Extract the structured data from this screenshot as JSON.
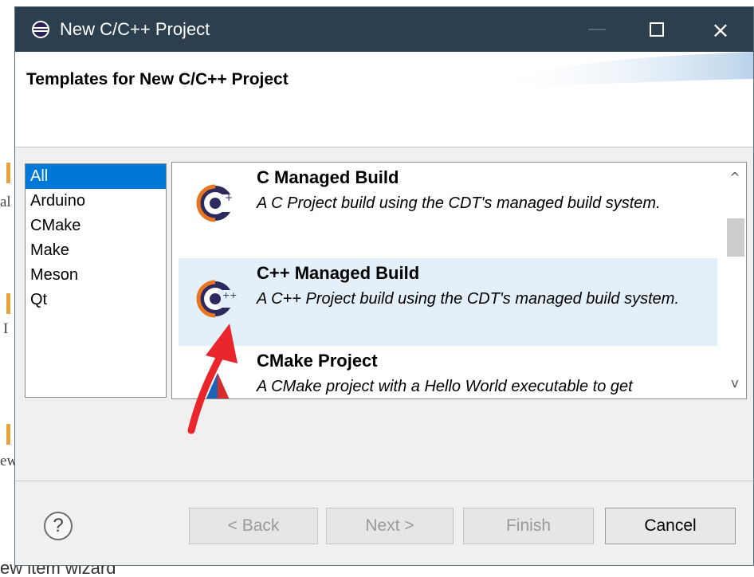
{
  "background": {
    "left_fragments": [
      "al",
      "I",
      "ew"
    ],
    "bottom_text": "ew item wizard"
  },
  "window": {
    "title": "New C/C++ Project",
    "app_icon": "eclipse-icon",
    "controls": {
      "minimize": "minimize-icon",
      "maximize": "maximize-icon",
      "close": "×"
    }
  },
  "header": {
    "title": "Templates for New C/C++ Project"
  },
  "categories": {
    "selected": "All",
    "items": [
      "All",
      "Arduino",
      "CMake",
      "Make",
      "Meson",
      "Qt"
    ]
  },
  "templates": {
    "selected": "C++ Managed Build",
    "items": [
      {
        "name": "C Managed Build",
        "description": "A C Project build using the CDT's managed build system.",
        "icon": "cdt-c-icon"
      },
      {
        "name": "C++ Managed Build",
        "description": "A C++ Project build using the CDT's managed build system.",
        "icon": "cdt-cpp-icon"
      },
      {
        "name": "CMake Project",
        "description": "A CMake project with a Hello World executable to get",
        "icon": "cmake-icon"
      }
    ],
    "scroll_up": "^",
    "scroll_down": "v"
  },
  "footer": {
    "help": "?",
    "back": "< Back",
    "next": "Next >",
    "finish": "Finish",
    "cancel": "Cancel"
  },
  "colors": {
    "titlebar": "#2b3f4e",
    "selection": "#0078d7",
    "selected_row": "#e3f0fa",
    "annotation_arrow": "#e8262b"
  }
}
